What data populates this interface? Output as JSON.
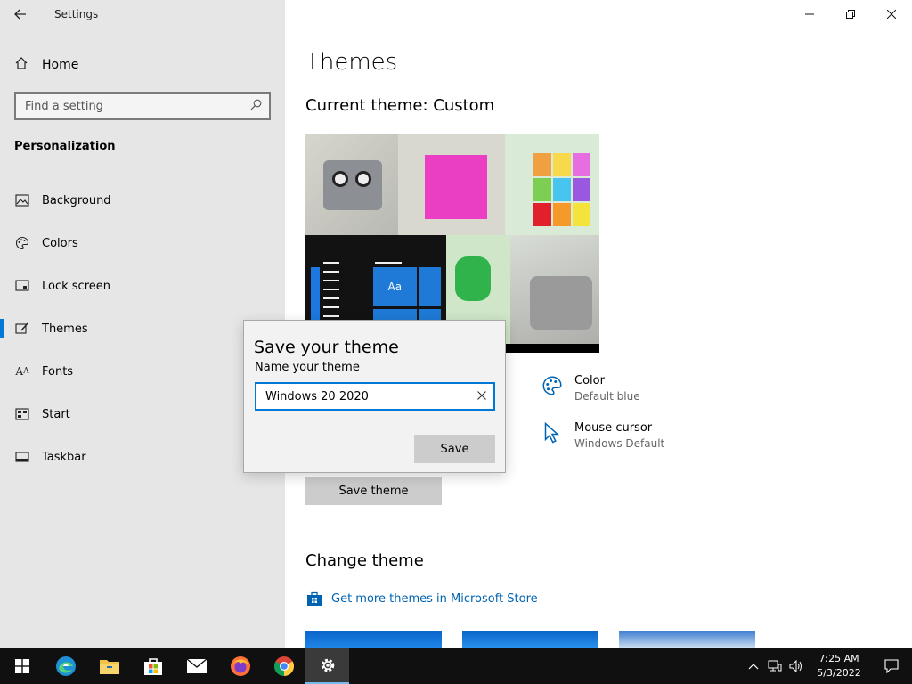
{
  "window": {
    "app_title": "Settings",
    "back_icon": "back-arrow-icon",
    "minimize_icon": "minimize-icon",
    "restore_icon": "restore-icon",
    "close_icon": "close-icon"
  },
  "sidebar": {
    "home_label": "Home",
    "search_placeholder": "Find a setting",
    "section_title": "Personalization",
    "active_item": "Themes",
    "accent_color": "#0078d7",
    "items": [
      {
        "label": "Background",
        "icon": "image-icon"
      },
      {
        "label": "Colors",
        "icon": "palette-icon"
      },
      {
        "label": "Lock screen",
        "icon": "lock-screen-icon"
      },
      {
        "label": "Themes",
        "icon": "brush-icon"
      },
      {
        "label": "Fonts",
        "icon": "font-icon"
      },
      {
        "label": "Start",
        "icon": "start-grid-icon"
      },
      {
        "label": "Taskbar",
        "icon": "taskbar-icon"
      }
    ]
  },
  "main": {
    "title": "Themes",
    "current_theme": "Current theme: Custom",
    "preview_tile_text": "Aa",
    "settings": [
      {
        "title": "Color",
        "value": "Default blue",
        "icon": "palette-icon"
      },
      {
        "title": "Mouse cursor",
        "value": "Windows Default",
        "icon": "cursor-icon"
      }
    ],
    "save_theme_button": "Save theme",
    "change_theme_title": "Change theme",
    "store_link": "Get more themes in Microsoft Store"
  },
  "dialog": {
    "title": "Save your theme",
    "label": "Name your theme",
    "input_value": "Windows 20 2020",
    "clear_icon": "clear-x-icon",
    "save_button": "Save"
  },
  "taskbar": {
    "apps": [
      "windows-start-icon",
      "edge-icon",
      "file-explorer-icon",
      "store-icon",
      "mail-icon",
      "firefox-icon",
      "chrome-icon",
      "settings-gear-icon"
    ],
    "active_app": "settings-gear-icon",
    "time": "7:25 AM",
    "date": "5/3/2022"
  }
}
